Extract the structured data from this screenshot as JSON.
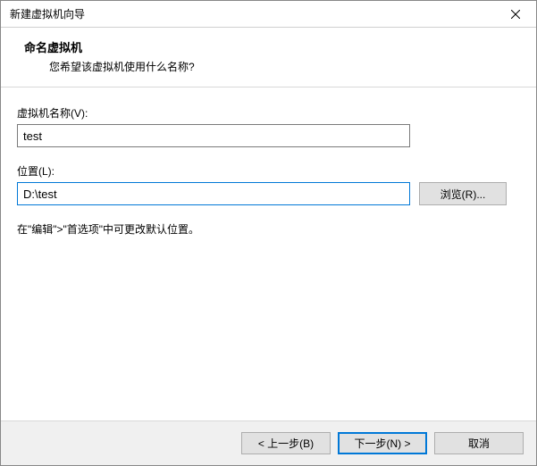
{
  "window": {
    "title": "新建虚拟机向导"
  },
  "header": {
    "heading": "命名虚拟机",
    "subheading": "您希望该虚拟机使用什么名称?"
  },
  "fields": {
    "name": {
      "label": "虚拟机名称(V):",
      "value": "test"
    },
    "location": {
      "label": "位置(L):",
      "value": "D:\\test",
      "browse_label": "浏览(R)..."
    },
    "hint": "在\"编辑\">\"首选项\"中可更改默认位置。"
  },
  "footer": {
    "back": "< 上一步(B)",
    "next": "下一步(N) >",
    "cancel": "取消"
  }
}
